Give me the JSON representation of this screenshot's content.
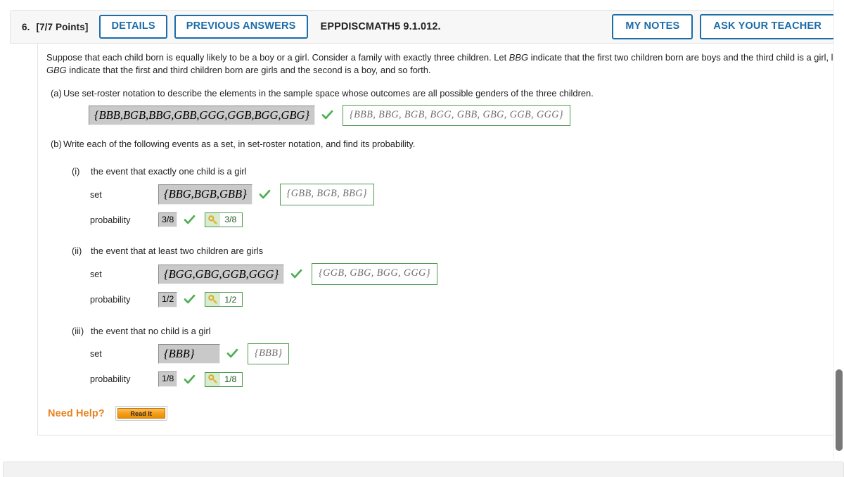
{
  "header": {
    "number": "6.",
    "points": "[7/7 Points]",
    "details_label": "DETAILS",
    "previous_answers_label": "PREVIOUS ANSWERS",
    "question_code": "EPPDISCMATH5 9.1.012.",
    "my_notes_label": "MY NOTES",
    "ask_teacher_label": "ASK YOUR TEACHER"
  },
  "prose": {
    "line1_a": "Suppose that each child born is equally likely to be a boy or a girl. Consider a family with exactly three children. Let ",
    "line1_italic": "BBG",
    "line1_b": " indicate that the first two children born are boys and the third child is a girl, let ",
    "line2_italic": "GBG",
    "line2_b": " indicate that the first and third children born are girls and the second is a boy, and so forth."
  },
  "parts": {
    "a": {
      "label": "(a)",
      "text": "Use set-roster notation to describe the elements in the sample space whose outcomes are all possible genders of the three children.",
      "answer": "{BBB,BGB,BBG,GBB,GGG,GGB,BGG,GBG}",
      "correct": "{BBB, BBG, BGB, BGG, GBB, GBG, GGB, GGG}"
    },
    "b": {
      "label": "(b)",
      "text": "Write each of the following events as a set, in set-roster notation, and find its probability.",
      "items": [
        {
          "label": "(i)",
          "text": "the event that exactly one child is a girl",
          "set_label": "set",
          "set_answer": "{BBG,BGB,GBB}",
          "set_correct": "{GBB, BGB, BBG}",
          "prob_label": "probability",
          "prob_answer": "3/8",
          "prob_correct": "3/8"
        },
        {
          "label": "(ii)",
          "text": "the event that at least two children are girls",
          "set_label": "set",
          "set_answer": "{BGG,GBG,GGB,GGG}",
          "set_correct": "{GGB, GBG, BGG, GGG}",
          "prob_label": "probability",
          "prob_answer": "1/2",
          "prob_correct": "1/2"
        },
        {
          "label": "(iii)",
          "text": "the event that no child is a girl",
          "set_label": "set",
          "set_answer": "{BBB}",
          "set_correct": "{BBB}",
          "prob_label": "probability",
          "prob_answer": "1/8",
          "prob_correct": "1/8"
        }
      ]
    }
  },
  "need_help": {
    "label": "Need Help?",
    "read_it_label": "Read It"
  },
  "icons": {
    "check": "green-check-icon",
    "key": "key-icon"
  },
  "colors": {
    "accent_blue": "#1c6ca8",
    "check_green": "#4caf50",
    "correct_border_green": "#4f9a4f",
    "need_help_orange": "#e8821e"
  }
}
